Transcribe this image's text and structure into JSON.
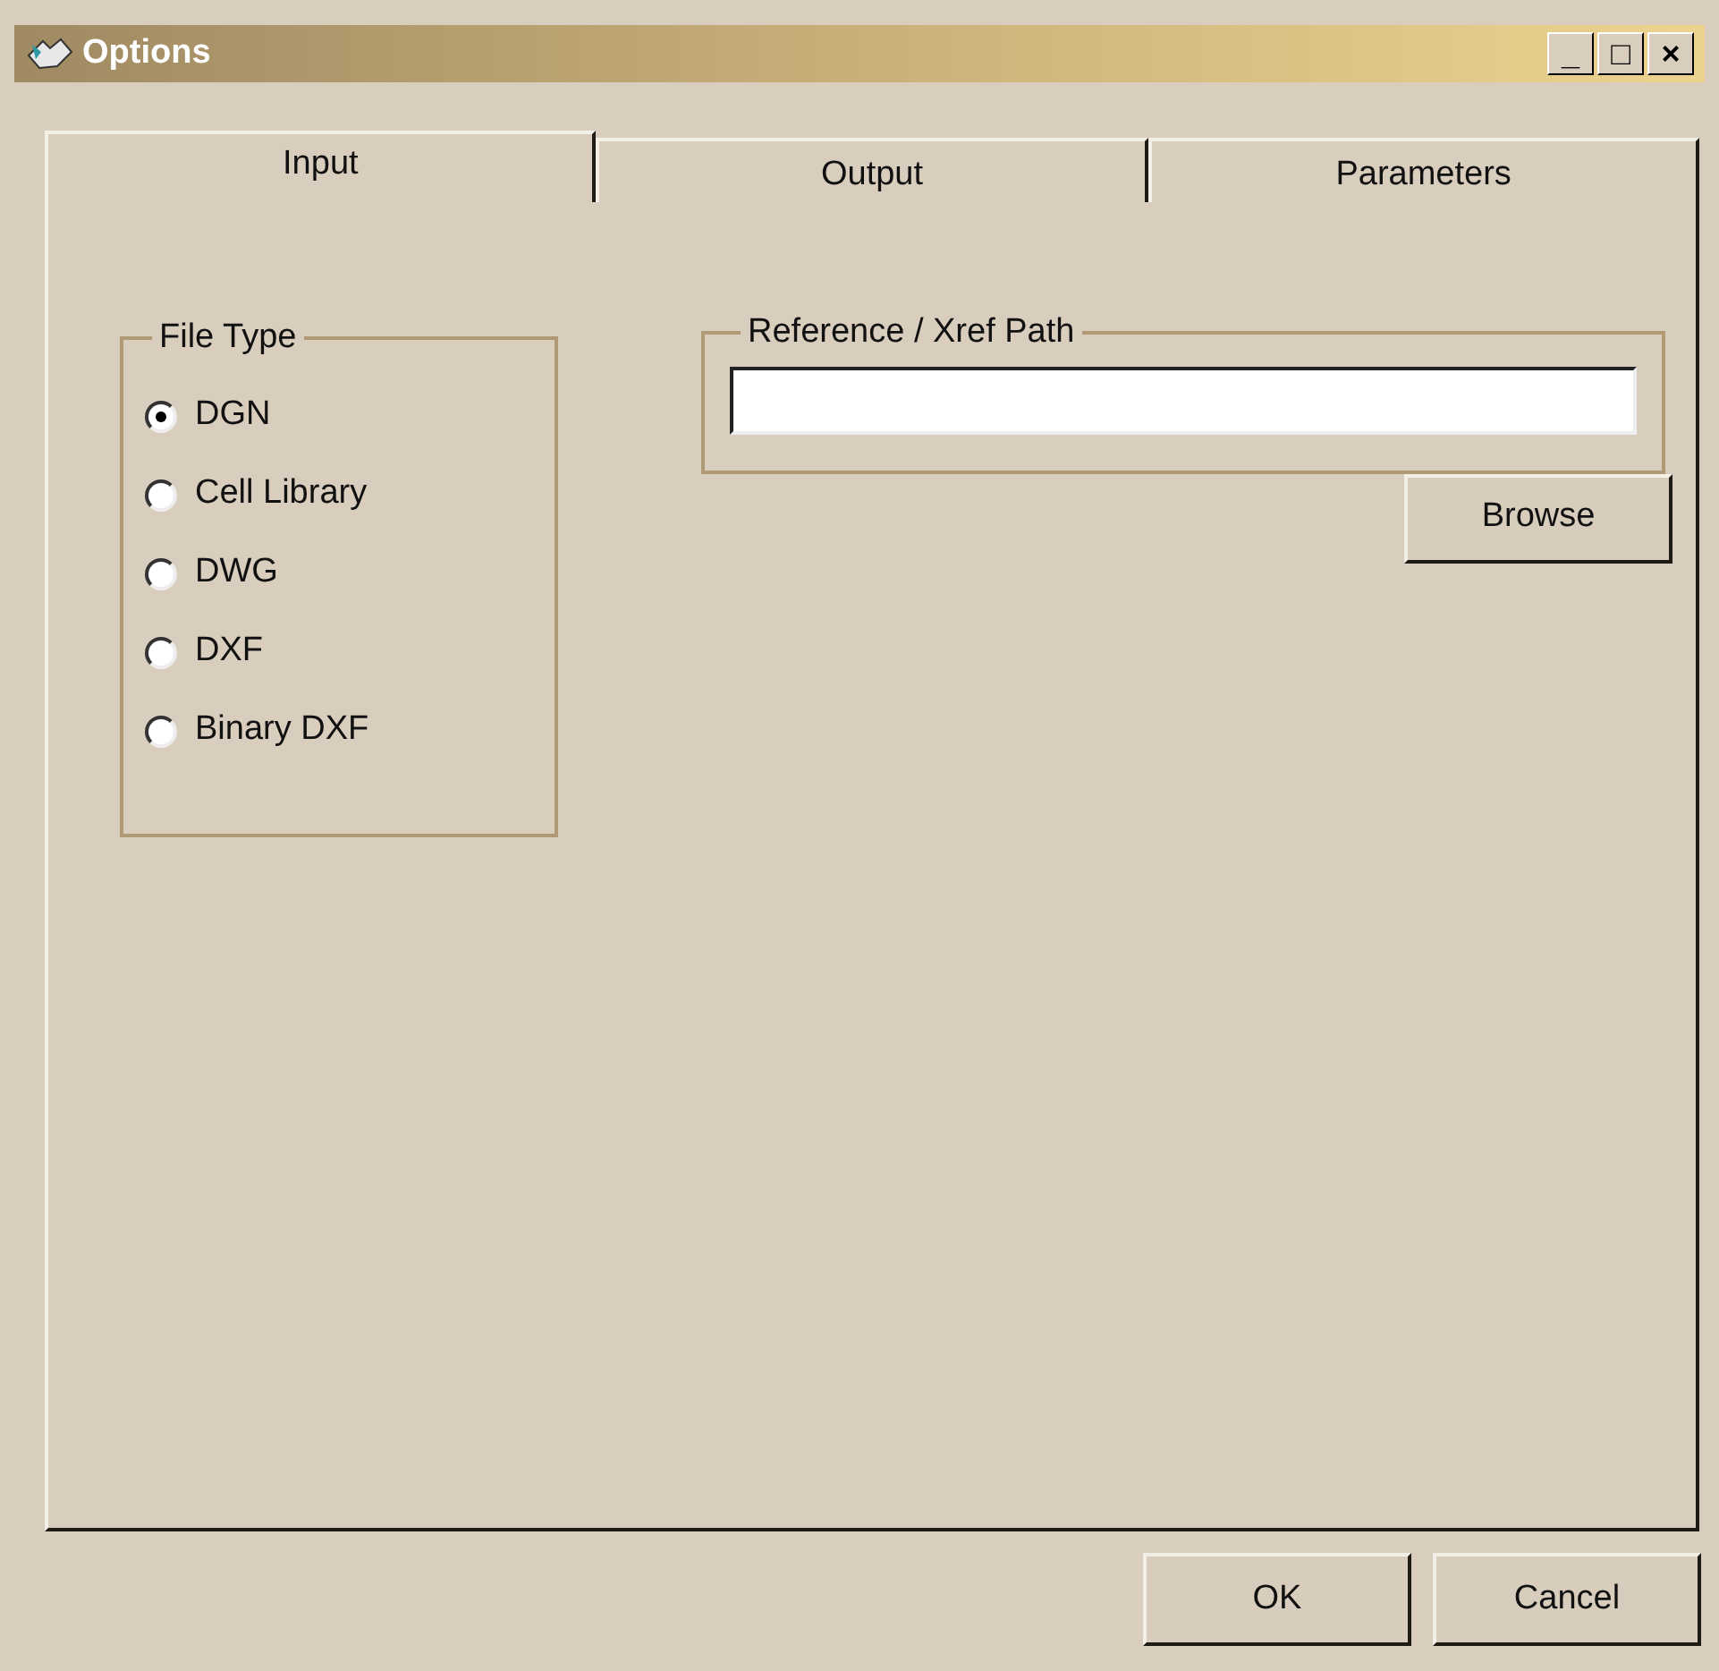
{
  "window": {
    "title": "Options",
    "controls": [
      "_",
      "□",
      "×"
    ]
  },
  "tabs": [
    {
      "label": "Input",
      "selected": true
    },
    {
      "label": "Output",
      "selected": false
    },
    {
      "label": "Parameters",
      "selected": false
    }
  ],
  "file_type": {
    "title": "File Type",
    "options": [
      {
        "label": "DGN",
        "selected": true
      },
      {
        "label": "Cell Library",
        "selected": false
      },
      {
        "label": "DWG",
        "selected": false
      },
      {
        "label": "DXF",
        "selected": false
      },
      {
        "label": "Binary DXF",
        "selected": false
      }
    ]
  },
  "reference_path": {
    "title": "Reference / Xref Path"
  },
  "browse_button": "Browse",
  "buttons": [
    "OK",
    "Cancel"
  ]
}
